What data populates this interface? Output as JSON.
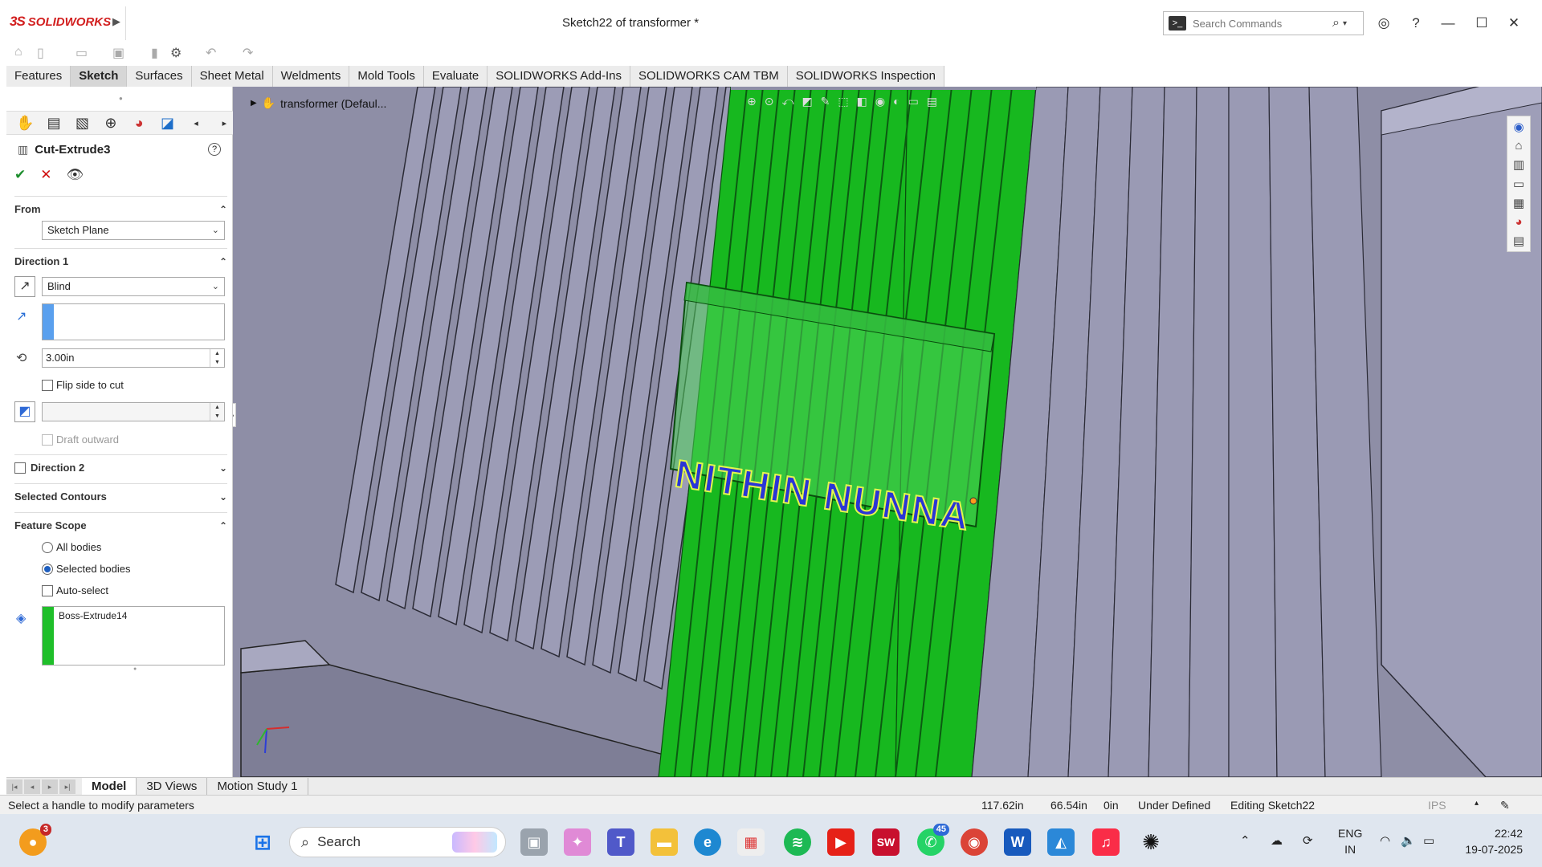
{
  "app": {
    "brand": "SOLIDWORKS",
    "document_title": "Sketch22 of transformer *",
    "search": {
      "placeholder": "Search Commands"
    }
  },
  "tabs": [
    {
      "label": "Features",
      "active": false
    },
    {
      "label": "Sketch",
      "active": true
    },
    {
      "label": "Surfaces",
      "active": false
    },
    {
      "label": "Sheet Metal",
      "active": false
    },
    {
      "label": "Weldments",
      "active": false
    },
    {
      "label": "Mold Tools",
      "active": false
    },
    {
      "label": "Evaluate",
      "active": false
    },
    {
      "label": "SOLIDWORKS Add-Ins",
      "active": false
    },
    {
      "label": "SOLIDWORKS CAM TBM",
      "active": false
    },
    {
      "label": "SOLIDWORKS Inspection",
      "active": false
    }
  ],
  "property_manager": {
    "title": "Cut-Extrude3",
    "from": {
      "header": "From",
      "value": "Sketch Plane"
    },
    "direction1": {
      "header": "Direction 1",
      "end_condition": "Blind",
      "depth": "3.00in",
      "flip_side_label": "Flip side to cut",
      "draft_outward_label": "Draft outward"
    },
    "direction2": {
      "header": "Direction 2"
    },
    "selected_contours": {
      "header": "Selected Contours"
    },
    "feature_scope": {
      "header": "Feature Scope",
      "all_bodies": "All bodies",
      "selected_bodies": "Selected bodies",
      "auto_select": "Auto-select",
      "bodies": [
        "Boss-Extrude14"
      ]
    }
  },
  "viewport": {
    "tree_label": "transformer  (Defaul...",
    "sketch_text": "NITHIN NUNNA",
    "colors": {
      "background": "#8e8ea6",
      "fins": "#9a9ab4",
      "selected": "#1fbf2a",
      "sketch_text": "#2a35d6"
    }
  },
  "bottom_tabs": [
    "Model",
    "3D Views",
    "Motion Study 1"
  ],
  "status": {
    "message": "Select a handle to modify parameters",
    "x": "117.62in",
    "y": "66.54in",
    "z": "0in",
    "state": "Under Defined",
    "editing": "Editing Sketch22",
    "units": "IPS"
  },
  "taskbar": {
    "search_label": "Search",
    "notification_badge": "3",
    "whatsapp_badge": "45",
    "lang_top": "ENG",
    "lang_bottom": "IN",
    "time": "22:42",
    "date": "19-07-2025"
  }
}
